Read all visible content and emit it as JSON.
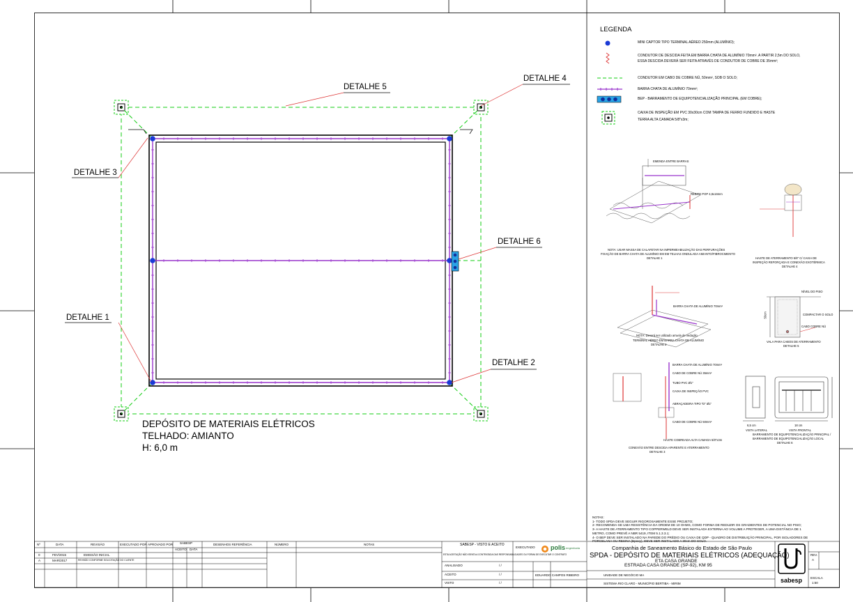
{
  "legend": {
    "title": "LEGENDA",
    "items": [
      {
        "icon": "mini-captor-dot",
        "text": "MINI CAPTOR TIPO TERMINAL AÉREO 250mm (ALUMÍNIO);"
      },
      {
        "icon": "descent-conductor-zigzag",
        "text": "CONDUTOR DE DESCIDA FEITA EM BARRA CHATA DE ALUMÍNIO 70mm². A PARTIR 2,5m DO SOLO,",
        "text2": "ESSA DESCIDA DEVERÁ SER FEITA ATRAVÉS DE CONDUTOR DE COBRE DE 35mm²;"
      },
      {
        "icon": "green-dashed-line",
        "text": "CONDUTOR EM CABO DE COBRE NÚ, 50mm², SOB O SOLO;"
      },
      {
        "icon": "purple-bar-line",
        "text": "BARRA CHATA DE ALUMÍNIO 70mm²;"
      },
      {
        "icon": "bep-bar",
        "text": "BEP - BARRAMENTO DE EQUIPOTENCIALIZAÇÃO PRINCIPAL (EM COBRE);"
      },
      {
        "icon": "inspection-box",
        "text": "CAIXA DE INSPEÇÃO EM PVC 30x30cm COM TAMPA DE FERRO FUNDIDO E HASTE",
        "text2": "TERRA ALTA CAMADA 5/8\"x3m;"
      }
    ]
  },
  "plan": {
    "details": {
      "d1": "DETALHE 1",
      "d2": "DETALHE 2",
      "d3": "DETALHE 3",
      "d4": "DETALHE 4",
      "d5": "DETALHE 5",
      "d6": "DETALHE 6"
    },
    "caption": {
      "line1": "DEPÓSITO DE MATERIAIS ELÉTRICOS",
      "line2": "TELHADO: AMIANTO",
      "line3": "H: 6,0 m"
    }
  },
  "details": {
    "d1_caption1": "NOTA: USAR MASSA DE CALAFETAR NA IMPERMEABILIZAÇÃO DAS PERFURAÇÕES",
    "d1_caption2": "FIXAÇÃO DE BARRA CHATA DE ALUMÍNIO EM EM TELHAS ONDULADA AMIANTO/FIBROCIMENTO",
    "d1_caption3": "DETALHE 1",
    "d2_caption1": "TERMINAL AÉREO EM BARRA CHATA DE ALUMÍNIO",
    "d2_caption2": "DETALHE 2",
    "d3_caption1": "CONEXÃO ENTRE DESCIDA APARENTE E ATERRAMENTO",
    "d3_caption2": "DETALHE 3",
    "d4_caption1": "HASTE DE ATERRAMENTO 5/8\" C/ CAIXA DE",
    "d4_caption2": "INSPEÇÃO REFORÇADA E CONEXÃO EXOTÉRMICA",
    "d4_caption3": "DETALHE 4",
    "d5_caption1": "VALA PARA CABOS DE ATERRAMENTO",
    "d5_caption2": "DETALHE 5",
    "d6_caption1": "BARRAMENTO DE EQUIPOTENCIALIZAÇÃO PRINCIPAL /",
    "d6_caption2": "BARRAMENTO DE EQUIPOTENCIALIZAÇÃO LOCAL",
    "d6_caption3": "DETALHE 6",
    "lat": "VISTA LATERAL",
    "front": "VISTA FRONTAL",
    "dim1": "6,5 cm",
    "dim2": "18 cm",
    "dim3": "50cm",
    "ground": "NÍVEL DO PISO",
    "compact": "COMPACTAR O SOLO",
    "cable": "CABO COBRE NÚ",
    "bar_label": "BARRA CHATA DE ALUMÍNIO 70mm²",
    "cable35": "CABO DE COBRE NÚ 35mm²",
    "pvc": "TUBO PVC Ø1\"",
    "box": "CAIXA DE INSPEÇÃO PVC",
    "clamp": "ABRAÇADEIRA TIPO \"D\" Ø1\"",
    "cable50": "CABO DE COBRE NÚ 50mm²",
    "rod": "HASTE COBREADA ALTA CAMADA 5/8\"x3m",
    "splice": "EMENDA ENTRE BARRAS",
    "rivet": "REBITE POP 4,8x16mm",
    "nota": "NOTA: Deverá ser utilizado arruela de vedação"
  },
  "notes": {
    "title": "NOTAS:",
    "lines": [
      "1- TODO SPDA DEVE SEGUIR RIGOROSAMENTE ESSE PROJETO;",
      "2- RECOMENDA-SE UMA RESISTÊNCIA DA ORDEM DE 10 OHMS, COMO FORMA DE REDUZIR OS GRADIENTES DE POTENCIAL NO PISO;",
      "3- A HASTE DE ATERRAMENTO TIPO COPPERWELD DEVE SER INSTALADA EXTERNA AO VOLUME A PROTEGER, A UMA DISTÂNCIA DE 1",
      "METRO, COMO PREVÊ A NBR 5419, ITEM 5.1.3.3.1;",
      "4- O BEP DEVE SER INSTALADO NA PAREDE DO PRÉDIO OU CAIXA DE QDP - QUADRO DE DISTRIBUIÇÃO PRINCIPAL, POR ISOLADORES DE",
      "PORCELANA OU RESINA (Epoxy), DEVE SER INSTALADO A 30cm DO SOLO."
    ]
  },
  "titleblock": {
    "headers": {
      "n": "Nº",
      "data": "DATA",
      "revisao": "REVISÃO",
      "exec": "EXECUTADO POR",
      "aprov": "APROVADO POR",
      "sabesp": "SABESP",
      "aceito": "ACEITO",
      "data2": "DATA",
      "desenhos": "DESENHOS REFERÊNCIA",
      "numero": "NÚMERO",
      "notas": "NOTAS"
    },
    "rows": [
      {
        "n": "0",
        "data": "FEV/2015",
        "revisao": "EMISSÃO INICIAL"
      },
      {
        "n": "A",
        "data": "MAR/2017",
        "revisao": "REVISÃO CONFORME SOLICITAÇÃO DO CLIENTE"
      }
    ],
    "sabesp_block": "SABESP - VISTO E ACEITO",
    "disclaimer": "ESTA ACEITAÇÃO NÃO ISENTA A CONTRATADA DAS RESPONSABILIDADES OU FORMA DE EXECUTAR O CONTRATO",
    "analisado": "ANALISADO",
    "aceito": "ACEITO",
    "visto": "VISTO",
    "executado": "EXECUTADO",
    "company_logo": "polis",
    "company_sub": "engenharia",
    "slash": "/ /",
    "company": "Companhia de Saneamento Básico do Estado de São Paulo",
    "title_line1": "SPDA - DEPÓSITO DE MATERIAIS ELÉTRICOS  (ADEQUAÇÃO)",
    "title_line2": "ETA CASA GRANDE",
    "title_line3": "ESTRADA CASA GRANDE (SP-92), KM 95",
    "unidade_label": "UNIDADE DE NEGÓCIO MA",
    "sistema": "SISTEMA RIO CLARO - MUNICÍPIO BERTIBA - MIRIM",
    "responsavel": "EDUARDO CAMPOS RIBEIRO",
    "sabesp_word": "sabesp",
    "rev_label": "REV.",
    "rev_value": "A",
    "escala_label": "ESCALA",
    "escala_value": "1:50"
  }
}
